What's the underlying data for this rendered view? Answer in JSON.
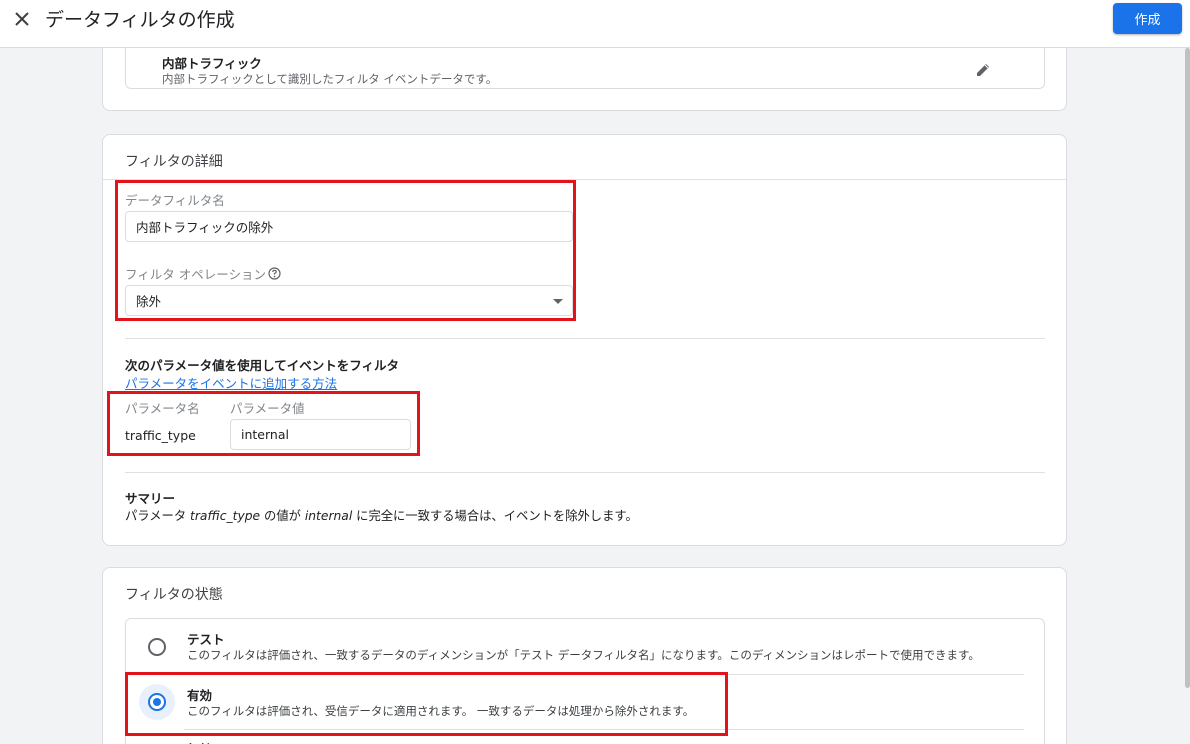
{
  "header": {
    "title": "データフィルタの作成",
    "create_label": "作成"
  },
  "colors": {
    "accent": "#1a73e8",
    "highlight": "#e3131b"
  },
  "filter_type": {
    "name": "内部トラフィック",
    "description": "内部トラフィックとして識別したフィルタ イベントデータです。"
  },
  "details": {
    "section_title": "フィルタの詳細",
    "name_label": "データフィルタ名",
    "name_value": "内部トラフィックの除外",
    "operation_label": "フィルタ オペレーション",
    "operation_value": "除外",
    "params_heading": "次のパラメータ値を使用してイベントをフィルタ",
    "params_link": "パラメータをイベントに追加する方法",
    "param_name_label": "パラメータ名",
    "param_value_label": "パラメータ値",
    "param_name": "traffic_type",
    "param_value": "internal",
    "summary_heading": "サマリー",
    "summary_prefix": "パラメータ ",
    "summary_param": "traffic_type",
    "summary_mid": " の値が ",
    "summary_value": "internal",
    "summary_suffix": " に完全に一致する場合は、イベントを除外します。"
  },
  "state": {
    "section_title": "フィルタの状態",
    "options": [
      {
        "label": "テスト",
        "description": "このフィルタは評価され、一致するデータのディメンションが「テスト データフィルタ名」になります。このディメンションはレポートで使用できます。",
        "selected": false
      },
      {
        "label": "有効",
        "description": "このフィルタは評価され、受信データに適用されます。 一致するデータは処理から除外されます。",
        "selected": true
      },
      {
        "label": "無効",
        "description": "",
        "selected": false
      }
    ]
  }
}
